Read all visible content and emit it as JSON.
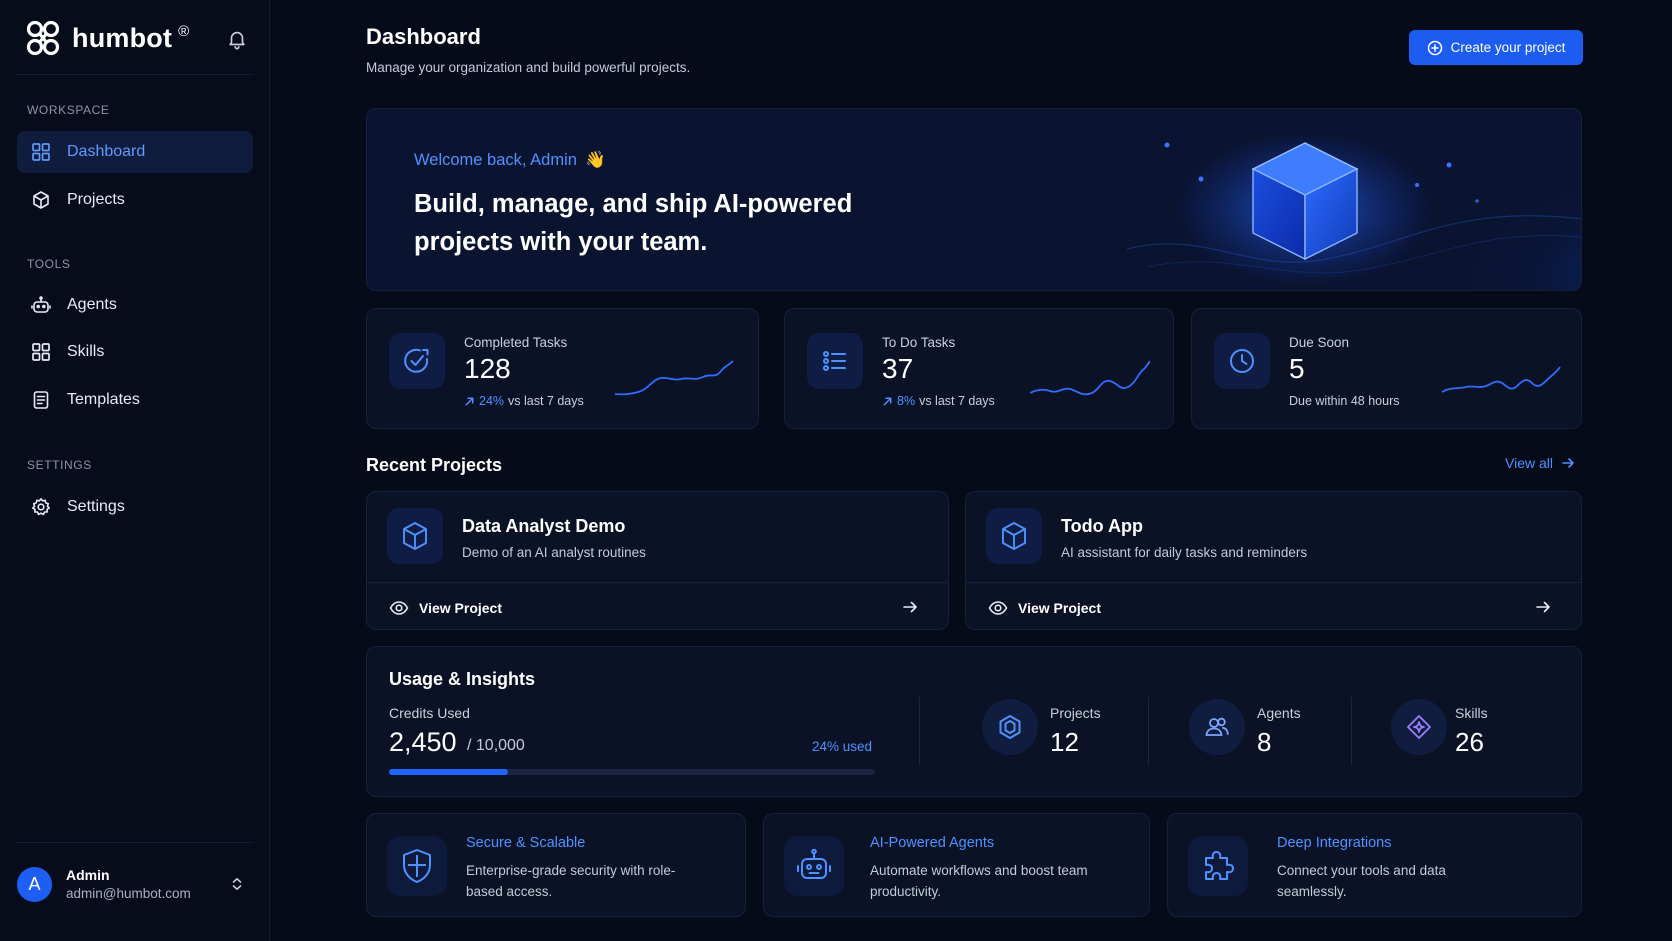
{
  "brand": {
    "name": "humbot",
    "reg": "®",
    "logo_icon": "humbot-logo-icon"
  },
  "sidebar": {
    "sections": [
      {
        "label": "WORKSPACE"
      },
      {
        "label": "TOOLS"
      },
      {
        "label": "SETTINGS"
      }
    ],
    "items": [
      {
        "label": "Dashboard",
        "icon": "grid-icon",
        "active": true
      },
      {
        "label": "Projects",
        "icon": "cube-icon"
      },
      {
        "label": "Agents",
        "icon": "robot-icon"
      },
      {
        "label": "Skills",
        "icon": "grid-icon"
      },
      {
        "label": "Templates",
        "icon": "document-icon"
      },
      {
        "label": "Settings",
        "icon": "gear-icon"
      }
    ],
    "user": {
      "initial": "A",
      "name": "Admin",
      "email": "admin@humbot.com"
    }
  },
  "header": {
    "title": "Dashboard",
    "subtitle": "Manage your organization and build powerful projects.",
    "create_label": "Create your project"
  },
  "hero": {
    "welcome": "Welcome back, Admin",
    "wave": "👋",
    "title": "Build, manage, and ship AI-powered projects with your team."
  },
  "stats": [
    {
      "label": "Completed Tasks",
      "value": "128",
      "pct": "24%",
      "trend": "vs last 7 days",
      "icon": "target-check-icon"
    },
    {
      "label": "To Do Tasks",
      "value": "37",
      "pct": "8%",
      "trend": "vs last 7 days",
      "icon": "checklist-icon"
    },
    {
      "label": "Due Soon",
      "value": "5",
      "note": "Due within 48 hours",
      "icon": "clock-icon"
    }
  ],
  "recent": {
    "title": "Recent Projects",
    "view_all": "View all",
    "projects": [
      {
        "name": "Data Analyst Demo",
        "desc": "Demo of an AI analyst routines",
        "action": "View Project"
      },
      {
        "name": "Todo App",
        "desc": "AI assistant for daily tasks and reminders",
        "action": "View Project"
      }
    ]
  },
  "usage": {
    "title": "Usage & Insights",
    "credits_label": "Credits Used",
    "credits_value": "2,450",
    "credits_total": "/ 10,000",
    "credits_pct_label": "24% used",
    "credits_fraction": 0.245,
    "metrics": [
      {
        "label": "Projects",
        "value": "12",
        "icon": "hexagon-icon"
      },
      {
        "label": "Agents",
        "value": "8",
        "icon": "users-icon"
      },
      {
        "label": "Skills",
        "value": "26",
        "icon": "sparkle-diamond-icon"
      }
    ]
  },
  "features": [
    {
      "title": "Secure & Scalable",
      "desc": "Enterprise-grade security with role-based access.",
      "icon": "shield-icon"
    },
    {
      "title": "AI-Powered Agents",
      "desc": "Automate workflows and boost team productivity.",
      "icon": "robot-icon"
    },
    {
      "title": "Deep Integrations",
      "desc": "Connect your tools and data seamlessly.",
      "icon": "puzzle-icon"
    }
  ],
  "colors": {
    "accent": "#1c5cf0",
    "accent_text": "#4d92ff",
    "background": "#060b1a",
    "card": "#0b1226"
  }
}
